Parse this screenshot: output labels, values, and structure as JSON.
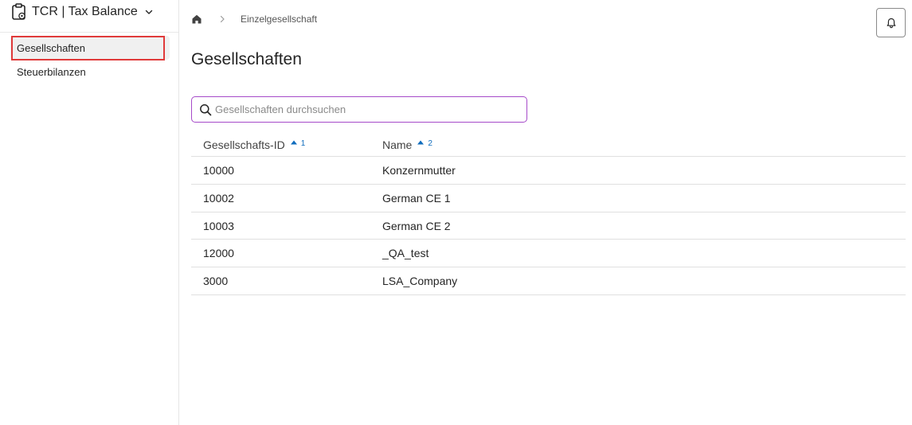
{
  "app": {
    "title": "TCR | Tax Balance"
  },
  "sidebar": {
    "items": [
      {
        "label": "Gesellschaften",
        "active": true
      },
      {
        "label": "Steuerbilanzen",
        "active": false
      }
    ]
  },
  "breadcrumb": {
    "current": "Einzelgesellschaft"
  },
  "page": {
    "title": "Gesellschaften"
  },
  "search": {
    "placeholder": "Gesellschaften durchsuchen",
    "value": ""
  },
  "table": {
    "columns": [
      {
        "label": "Gesellschafts-ID",
        "sort": "ascending",
        "sort_order": "1"
      },
      {
        "label": "Name",
        "sort": "ascending",
        "sort_order": "2"
      }
    ],
    "rows": [
      {
        "id": "10000",
        "name": "Konzernmutter"
      },
      {
        "id": "10002",
        "name": "German CE 1"
      },
      {
        "id": "10003",
        "name": "German CE 2"
      },
      {
        "id": "12000",
        "name": "_QA_test"
      },
      {
        "id": "3000",
        "name": "LSA_Company"
      }
    ]
  },
  "colors": {
    "accent_blue": "#0f6cbd",
    "search_border": "#a64ac9",
    "highlight_red": "#e03a3a"
  },
  "icons": {
    "app": "clipboard-settings-icon",
    "home": "home-icon",
    "notifications": "bell-icon",
    "search": "search-icon"
  }
}
